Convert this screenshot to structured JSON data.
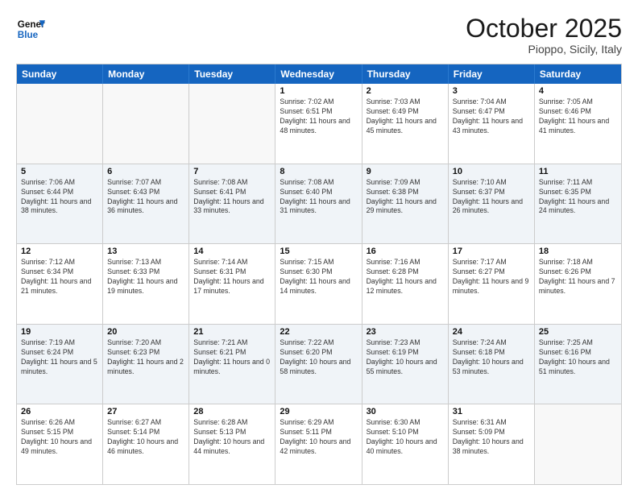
{
  "header": {
    "logo_line1": "General",
    "logo_line2": "Blue",
    "month": "October 2025",
    "location": "Pioppo, Sicily, Italy"
  },
  "weekdays": [
    "Sunday",
    "Monday",
    "Tuesday",
    "Wednesday",
    "Thursday",
    "Friday",
    "Saturday"
  ],
  "rows": [
    [
      {
        "day": "",
        "info": ""
      },
      {
        "day": "",
        "info": ""
      },
      {
        "day": "",
        "info": ""
      },
      {
        "day": "1",
        "info": "Sunrise: 7:02 AM\nSunset: 6:51 PM\nDaylight: 11 hours and 48 minutes."
      },
      {
        "day": "2",
        "info": "Sunrise: 7:03 AM\nSunset: 6:49 PM\nDaylight: 11 hours and 45 minutes."
      },
      {
        "day": "3",
        "info": "Sunrise: 7:04 AM\nSunset: 6:47 PM\nDaylight: 11 hours and 43 minutes."
      },
      {
        "day": "4",
        "info": "Sunrise: 7:05 AM\nSunset: 6:46 PM\nDaylight: 11 hours and 41 minutes."
      }
    ],
    [
      {
        "day": "5",
        "info": "Sunrise: 7:06 AM\nSunset: 6:44 PM\nDaylight: 11 hours and 38 minutes."
      },
      {
        "day": "6",
        "info": "Sunrise: 7:07 AM\nSunset: 6:43 PM\nDaylight: 11 hours and 36 minutes."
      },
      {
        "day": "7",
        "info": "Sunrise: 7:08 AM\nSunset: 6:41 PM\nDaylight: 11 hours and 33 minutes."
      },
      {
        "day": "8",
        "info": "Sunrise: 7:08 AM\nSunset: 6:40 PM\nDaylight: 11 hours and 31 minutes."
      },
      {
        "day": "9",
        "info": "Sunrise: 7:09 AM\nSunset: 6:38 PM\nDaylight: 11 hours and 29 minutes."
      },
      {
        "day": "10",
        "info": "Sunrise: 7:10 AM\nSunset: 6:37 PM\nDaylight: 11 hours and 26 minutes."
      },
      {
        "day": "11",
        "info": "Sunrise: 7:11 AM\nSunset: 6:35 PM\nDaylight: 11 hours and 24 minutes."
      }
    ],
    [
      {
        "day": "12",
        "info": "Sunrise: 7:12 AM\nSunset: 6:34 PM\nDaylight: 11 hours and 21 minutes."
      },
      {
        "day": "13",
        "info": "Sunrise: 7:13 AM\nSunset: 6:33 PM\nDaylight: 11 hours and 19 minutes."
      },
      {
        "day": "14",
        "info": "Sunrise: 7:14 AM\nSunset: 6:31 PM\nDaylight: 11 hours and 17 minutes."
      },
      {
        "day": "15",
        "info": "Sunrise: 7:15 AM\nSunset: 6:30 PM\nDaylight: 11 hours and 14 minutes."
      },
      {
        "day": "16",
        "info": "Sunrise: 7:16 AM\nSunset: 6:28 PM\nDaylight: 11 hours and 12 minutes."
      },
      {
        "day": "17",
        "info": "Sunrise: 7:17 AM\nSunset: 6:27 PM\nDaylight: 11 hours and 9 minutes."
      },
      {
        "day": "18",
        "info": "Sunrise: 7:18 AM\nSunset: 6:26 PM\nDaylight: 11 hours and 7 minutes."
      }
    ],
    [
      {
        "day": "19",
        "info": "Sunrise: 7:19 AM\nSunset: 6:24 PM\nDaylight: 11 hours and 5 minutes."
      },
      {
        "day": "20",
        "info": "Sunrise: 7:20 AM\nSunset: 6:23 PM\nDaylight: 11 hours and 2 minutes."
      },
      {
        "day": "21",
        "info": "Sunrise: 7:21 AM\nSunset: 6:21 PM\nDaylight: 11 hours and 0 minutes."
      },
      {
        "day": "22",
        "info": "Sunrise: 7:22 AM\nSunset: 6:20 PM\nDaylight: 10 hours and 58 minutes."
      },
      {
        "day": "23",
        "info": "Sunrise: 7:23 AM\nSunset: 6:19 PM\nDaylight: 10 hours and 55 minutes."
      },
      {
        "day": "24",
        "info": "Sunrise: 7:24 AM\nSunset: 6:18 PM\nDaylight: 10 hours and 53 minutes."
      },
      {
        "day": "25",
        "info": "Sunrise: 7:25 AM\nSunset: 6:16 PM\nDaylight: 10 hours and 51 minutes."
      }
    ],
    [
      {
        "day": "26",
        "info": "Sunrise: 6:26 AM\nSunset: 5:15 PM\nDaylight: 10 hours and 49 minutes."
      },
      {
        "day": "27",
        "info": "Sunrise: 6:27 AM\nSunset: 5:14 PM\nDaylight: 10 hours and 46 minutes."
      },
      {
        "day": "28",
        "info": "Sunrise: 6:28 AM\nSunset: 5:13 PM\nDaylight: 10 hours and 44 minutes."
      },
      {
        "day": "29",
        "info": "Sunrise: 6:29 AM\nSunset: 5:11 PM\nDaylight: 10 hours and 42 minutes."
      },
      {
        "day": "30",
        "info": "Sunrise: 6:30 AM\nSunset: 5:10 PM\nDaylight: 10 hours and 40 minutes."
      },
      {
        "day": "31",
        "info": "Sunrise: 6:31 AM\nSunset: 5:09 PM\nDaylight: 10 hours and 38 minutes."
      },
      {
        "day": "",
        "info": ""
      }
    ]
  ]
}
